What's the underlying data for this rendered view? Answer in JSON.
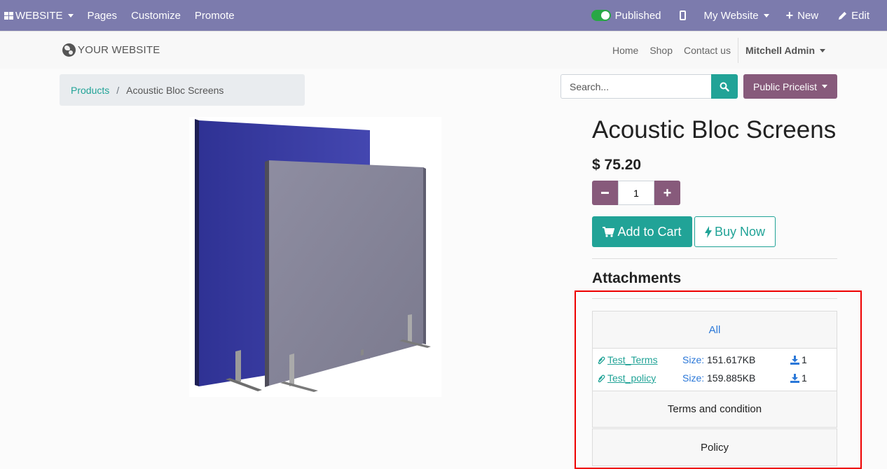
{
  "admin_bar": {
    "website_label": "WEBSITE",
    "pages": "Pages",
    "customize": "Customize",
    "promote": "Promote",
    "published": "Published",
    "my_website": "My Website",
    "new": "New",
    "edit": "Edit"
  },
  "header": {
    "logo": "YOUR WEBSITE",
    "nav": [
      "Home",
      "Shop",
      "Contact us"
    ],
    "user": "Mitchell Admin"
  },
  "breadcrumb": {
    "parent": "Products",
    "separator": "/",
    "current": "Acoustic Bloc Screens"
  },
  "search": {
    "placeholder": "Search..."
  },
  "pricelist": "Public Pricelist",
  "product": {
    "title": "Acoustic Bloc Screens",
    "price": "$ 75.20",
    "quantity": "1",
    "add_to_cart": "Add to Cart",
    "buy_now": "Buy Now"
  },
  "attachments": {
    "title": "Attachments",
    "sections": [
      "All",
      "Terms and condition",
      "Policy"
    ],
    "files": [
      {
        "name": "Test_Terms",
        "size_label": "Size:",
        "size": "151.617KB",
        "downloads": "1"
      },
      {
        "name": "Test_policy",
        "size_label": "Size:",
        "size": "159.885KB",
        "downloads": "1"
      }
    ]
  },
  "colors": {
    "admin_bar": "#7c7bad",
    "primary_teal": "#21a397",
    "secondary_purple": "#875a7b",
    "highlight_red": "#e00000"
  }
}
